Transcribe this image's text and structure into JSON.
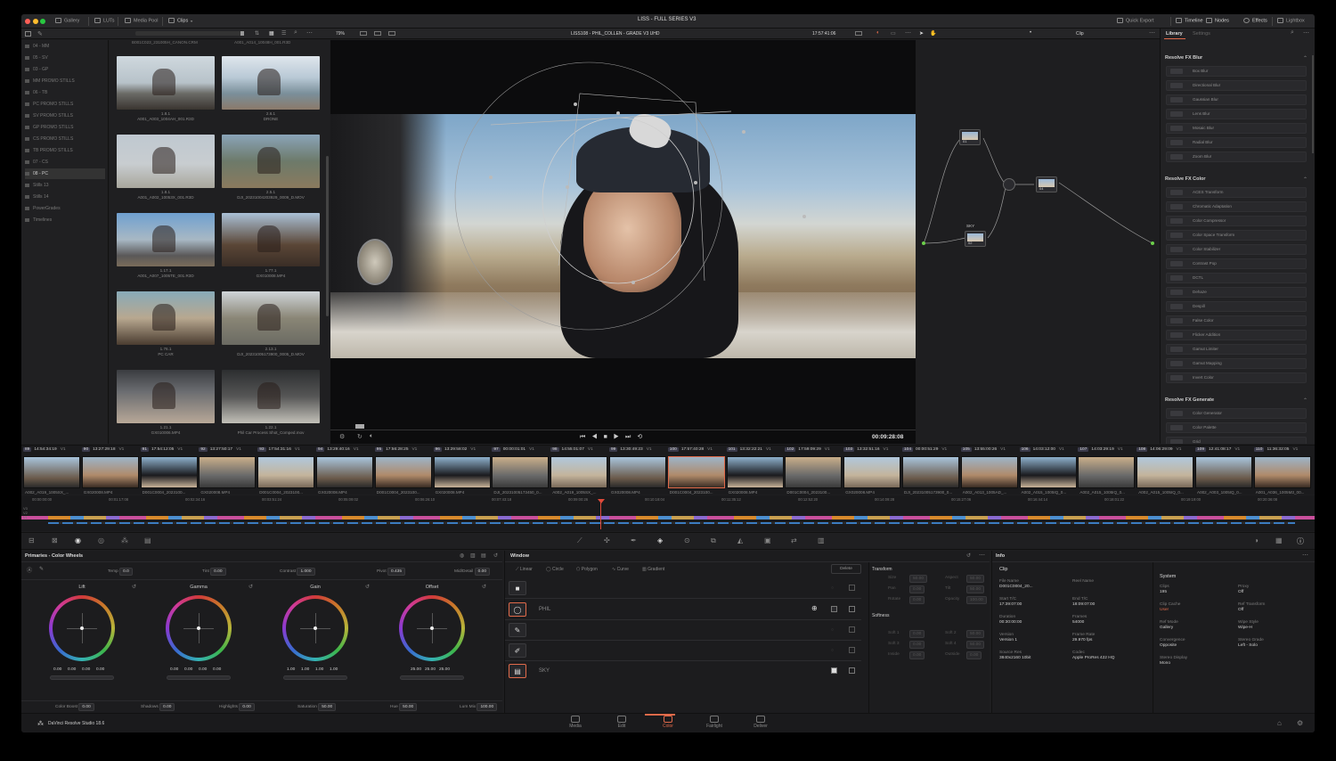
{
  "app": {
    "title": "LISS - FULL SERIES  V3",
    "product": "DaVinci Resolve Studio 18.6"
  },
  "toolbar": {
    "gallery": "Gallery",
    "luts": "LUTs",
    "media_pool": "Media Pool",
    "clips": "Clips",
    "quick_export": "Quick Export",
    "timeline": "Timeline",
    "nodes": "Nodes",
    "effects": "Effects",
    "lightbox": "Lightbox"
  },
  "viewer_bar": {
    "zoom": "79%",
    "clip_title": "LISS108 - PHIL_COLLEN - GRADE V3  UHD",
    "timecode": "17:57:41:06",
    "clip_mode": "Clip",
    "playhead_tc": "00:09:28:08"
  },
  "bins": [
    "04 - MM",
    "05 - SV",
    "03 - GP",
    "MM PROMO STILLS",
    "06 - TB",
    "PC PROMO STILLS",
    "SV PROMO STILLS",
    "GP PROMO STILLS",
    "CS PROMO STILLS",
    "TB PROMO STILLS",
    "07 - CS",
    "08 - PC",
    "Stills 13",
    "Stills 14",
    "PowerGrades",
    "Timelines"
  ],
  "selected_bin": "08 - PC",
  "gallery_top": [
    "B001C023_231005H_CANON.CRM",
    "A001_A014_10048H_001.R3D"
  ],
  "gallery": [
    {
      "id": "1.8.1",
      "name": "A001_A003_1004AH_001.R3D"
    },
    {
      "id": "2.6.1",
      "name": "DRONE"
    },
    {
      "id": "1.8.1",
      "name": "A001_A002_10053X_001.R3D"
    },
    {
      "id": "2.5.1",
      "name": "DJI_20231004203929_0009_D.MOV"
    },
    {
      "id": "1.17.1",
      "name": "A001_A007_1005TE_001.R3D"
    },
    {
      "id": "1.77.1",
      "name": "GX010008.MP4"
    },
    {
      "id": "1.76.1",
      "name": "PC CAR"
    },
    {
      "id": "2.13.1",
      "name": "DJI_20231005173900_0005_D.MOV"
    },
    {
      "id": "1.21.1",
      "name": "GX010006.MP4"
    },
    {
      "id": "1.22.1",
      "name": "Phil Car Process Shot_Comped.mov"
    }
  ],
  "library": {
    "tab_library": "Library",
    "tab_settings": "Settings",
    "sections": [
      {
        "title": "Resolve FX Blur",
        "items": [
          "Box Blur",
          "Directional Blur",
          "Gaussian Blur",
          "Lens Blur",
          "Mosaic Blur",
          "Radial Blur",
          "Zoom Blur"
        ]
      },
      {
        "title": "Resolve FX Color",
        "items": [
          "ACES Transform",
          "Chromatic Adaptation",
          "Color Compressor",
          "Color Space Transform",
          "Color Stabilizer",
          "Contrast Pop",
          "DCTL",
          "Dehaze",
          "Despill",
          "False Color",
          "Flicker Addition",
          "Gamut Limiter",
          "Gamut Mapping",
          "Invert Color"
        ]
      },
      {
        "title": "Resolve FX Generate",
        "items": [
          "Color Generator",
          "Color Palette",
          "Grid"
        ]
      }
    ]
  },
  "nodes": [
    {
      "label": "01"
    },
    {
      "label": "04"
    },
    {
      "label": "02",
      "name": "SKY"
    }
  ],
  "clips": [
    {
      "num": "89",
      "tc": "14:54:34:19",
      "track": "V1",
      "name": "A002_A019_1005SX_..."
    },
    {
      "num": "90",
      "tc": "13:27:29:18",
      "track": "V1",
      "name": "GX020008.MP4"
    },
    {
      "num": "91",
      "tc": "17:54:12:05",
      "track": "V1",
      "name": "D001C0004_2023100..."
    },
    {
      "num": "92",
      "tc": "13:27:50:17",
      "track": "V1",
      "name": "GX020008.MP4"
    },
    {
      "num": "93",
      "tc": "17:54:31:16",
      "track": "V1",
      "name": "D001C0004_2023100..."
    },
    {
      "num": "94",
      "tc": "13:29:40:16",
      "track": "V1",
      "name": "GX020008.MP4"
    },
    {
      "num": "95",
      "tc": "17:56:28:25",
      "track": "V1",
      "name": "D001C0004_2023100..."
    },
    {
      "num": "96",
      "tc": "13:29:58:02",
      "track": "V1",
      "name": "GX020008.MP4"
    },
    {
      "num": "97",
      "tc": "00:00:01:01",
      "track": "V1",
      "name": "DJI_20231005173450_0..."
    },
    {
      "num": "98",
      "tc": "14:55:01:07",
      "track": "V1",
      "name": "A002_A019_1005SX_..."
    },
    {
      "num": "99",
      "tc": "13:30:49:23",
      "track": "V1",
      "name": "GX020008.MP4"
    },
    {
      "num": "100",
      "tc": "17:57:40:28",
      "track": "V1",
      "name": "D001C0004_2023100..."
    },
    {
      "num": "101",
      "tc": "13:32:22:21",
      "track": "V1",
      "name": "GX020008.MP4"
    },
    {
      "num": "102",
      "tc": "17:59:09:29",
      "track": "V1",
      "name": "D001C0004_2023100..."
    },
    {
      "num": "103",
      "tc": "13:32:51:16",
      "track": "V1",
      "name": "GX020008.MP4"
    },
    {
      "num": "104",
      "tc": "00:00:51:29",
      "track": "V1",
      "name": "DJI_20231005173900_0..."
    },
    {
      "num": "105",
      "tc": "13:55:00:26",
      "track": "V1",
      "name": "A002_A013_1005AD_..."
    },
    {
      "num": "106",
      "tc": "14:03:12:00",
      "track": "V1",
      "name": "A002_A015_1005IQ_0..."
    },
    {
      "num": "107",
      "tc": "14:03:29:19",
      "track": "V1",
      "name": "A002_A015_1005IQ_0..."
    },
    {
      "num": "108",
      "tc": "14:06:29:09",
      "track": "V1",
      "name": "A002_A015_1005IQ_0..."
    },
    {
      "num": "109",
      "tc": "12:41:08:17",
      "track": "V1",
      "name": "A002_A003_1005IQ_0..."
    },
    {
      "num": "110",
      "tc": "11:36:32:05",
      "track": "V1",
      "name": "A001_A036_1005M3_00..."
    }
  ],
  "ruler": [
    "00:00:00:00",
    "00:01:17:08",
    "00:02:34:16",
    "00:03:51:24",
    "00:05:09:02",
    "00:06:26:10",
    "00:07:43:18",
    "00:09:00:26",
    "00:10:18:04",
    "00:11:35:12",
    "00:12:52:20",
    "00:14:09:28",
    "00:15:27:06",
    "00:16:44:14",
    "00:18:01:22",
    "00:19:19:00",
    "00:20:36:08"
  ],
  "tracks": [
    "V3",
    "V2",
    "V1"
  ],
  "primaries": {
    "title": "Primaries - Color Wheels",
    "temp_label": "Temp",
    "temp": "0.0",
    "tint_label": "Tint",
    "tint": "0.00",
    "contrast_label": "Contrast",
    "contrast": "1.000",
    "pivot_label": "Pivot",
    "pivot": "0.435",
    "middetail_label": "Mid/Detail",
    "middetail": "0.00",
    "wheels": [
      {
        "name": "Lift",
        "values": [
          "0.00",
          "0.00",
          "0.00",
          "0.00"
        ]
      },
      {
        "name": "Gamma",
        "values": [
          "0.00",
          "0.00",
          "0.00",
          "0.00"
        ]
      },
      {
        "name": "Gain",
        "values": [
          "1.00",
          "1.00",
          "1.00",
          "1.00"
        ]
      },
      {
        "name": "Offset",
        "values": [
          "25.00",
          "25.00",
          "25.00"
        ]
      }
    ],
    "colorboost_label": "Color Boost",
    "colorboost": "0.00",
    "shadows_label": "Shadows",
    "shadows": "0.00",
    "highlights_label": "Highlights",
    "highlights": "0.00",
    "saturation_label": "Saturation",
    "saturation": "50.00",
    "hue_label": "Hue",
    "hue": "50.00",
    "lummix_label": "Lum Mix",
    "lummix": "100.00"
  },
  "window": {
    "title": "Window",
    "linear": "Linear",
    "circle": "Circle",
    "polygon": "Polygon",
    "curve": "Curve",
    "gradient": "Gradient",
    "delete": "Delete",
    "shape_phil": "PHIL",
    "shape_sky": "SKY",
    "transform": "Transform",
    "size": "Size",
    "size_v": "50.00",
    "aspect": "Aspect",
    "aspect_v": "50.00",
    "pan": "Pan",
    "pan_v": "0.00",
    "tilt": "Tilt",
    "tilt_v": "50.00",
    "rotate": "Rotate",
    "rotate_v": "0.00",
    "opacity": "Opacity",
    "opacity_v": "100.00",
    "softness": "Softness",
    "soft1": "Soft 1",
    "soft1_v": "0.00",
    "soft2": "Soft 2",
    "soft2_v": "50.00",
    "soft3": "Soft 3",
    "soft3_v": "0.00",
    "soft4": "Soft 4",
    "soft4_v": "50.00",
    "inside": "Inside",
    "inside_v": "0.00",
    "outside": "Outside",
    "outside_v": "0.00"
  },
  "info": {
    "title": "Info",
    "clip_header": "Clip",
    "system_header": "System",
    "clip": [
      {
        "k": "File Name",
        "v": "D001C0004_20..."
      },
      {
        "k": "Reel Name",
        "v": ""
      },
      {
        "k": "Start T/C",
        "v": "17:39:07:00"
      },
      {
        "k": "End T/C",
        "v": "18:09:07:00"
      },
      {
        "k": "Duration",
        "v": "00:30:00:00"
      },
      {
        "k": "Frames",
        "v": "54000"
      },
      {
        "k": "Version",
        "v": "Version 1"
      },
      {
        "k": "Frame Rate",
        "v": "29.970 fps"
      },
      {
        "k": "Source Res",
        "v": "3840x2160 10bit"
      },
      {
        "k": "Codec",
        "v": "Apple ProRes 422 HQ"
      }
    ],
    "system": [
      {
        "k": "Clips",
        "v": "195"
      },
      {
        "k": "Proxy",
        "v": "Off"
      },
      {
        "k": "Clip Cache",
        "v": "User"
      },
      {
        "k": "Ref Transform",
        "v": "Off"
      },
      {
        "k": "Ref Mode",
        "v": "Gallery"
      },
      {
        "k": "Wipe Style",
        "v": "Wipe-H"
      },
      {
        "k": "Convergence",
        "v": "Opposite"
      },
      {
        "k": "Stereo Grade",
        "v": "Left - Solo"
      },
      {
        "k": "Stereo Display",
        "v": "Mono"
      }
    ]
  },
  "pages": [
    "Media",
    "Edit",
    "Color",
    "Fairlight",
    "Deliver"
  ],
  "active_page": "Color"
}
